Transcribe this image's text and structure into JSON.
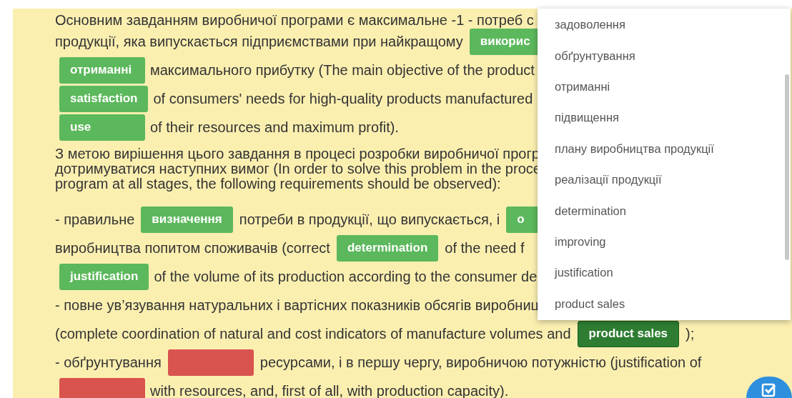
{
  "lines": [
    {
      "segments": [
        {
          "kind": "text",
          "text": "Основним завданням виробничої програми є максимальне -1 - потреб с"
        }
      ]
    },
    {
      "segments": [
        {
          "kind": "text",
          "text": "продукції, яка випускається підприємствами при найкращому"
        },
        {
          "kind": "blank",
          "text": "викорис",
          "filled": true,
          "selected": false
        }
      ]
    },
    {
      "segments": [
        {
          "kind": "blank",
          "text": "отриманні",
          "filled": true,
          "selected": false
        },
        {
          "kind": "text",
          "text": "максимального прибутку (The main objective of the product"
        }
      ]
    },
    {
      "segments": [
        {
          "kind": "blank",
          "text": "satisfaction",
          "filled": true,
          "selected": false
        },
        {
          "kind": "text",
          "text": "of consumers' needs for high-quality products manufactured"
        }
      ]
    },
    {
      "segments": [
        {
          "kind": "blank",
          "text": "use",
          "filled": true,
          "selected": false
        },
        {
          "kind": "text",
          "text": "of their resources and maximum profit)."
        }
      ]
    },
    {
      "segments": [
        {
          "kind": "text",
          "text": "З метою вирішення цього завдання в процесі розробки виробничої прогр"
        }
      ]
    },
    {
      "segments": [
        {
          "kind": "text",
          "text": "дотримуватися наступних вимог (In order to solve this problem in the proce"
        }
      ]
    },
    {
      "segments": [
        {
          "kind": "text",
          "text": "program at all stages, the following requirements should be observed):"
        }
      ]
    },
    {
      "segments": [
        {
          "kind": "text",
          "text": "- правильне"
        },
        {
          "kind": "blank",
          "text": "визначення",
          "filled": true,
          "selected": false
        },
        {
          "kind": "text",
          "text": "потреби в продукції, що випускається, і"
        },
        {
          "kind": "blank",
          "text": "о",
          "filled": true,
          "selected": false
        }
      ]
    },
    {
      "segments": [
        {
          "kind": "text",
          "text": "виробництва попитом споживачів (correct"
        },
        {
          "kind": "blank",
          "text": "determination",
          "filled": true,
          "selected": false
        },
        {
          "kind": "text",
          "text": "of the need f"
        }
      ]
    },
    {
      "segments": [
        {
          "kind": "blank",
          "text": "justification",
          "filled": true,
          "selected": false
        },
        {
          "kind": "text",
          "text": "of the volume of its production according to the consumer de"
        }
      ]
    },
    {
      "segments": [
        {
          "kind": "text",
          "text": "- повне ув’язування натуральних і вартісних показників обсягів виробниц"
        }
      ]
    },
    {
      "segments": [
        {
          "kind": "text",
          "text": "(complete coordination of natural and cost indicators of manufacture volumes and"
        },
        {
          "kind": "blank",
          "text": "product sales",
          "filled": true,
          "selected": true
        },
        {
          "kind": "text",
          "text": ");"
        }
      ]
    },
    {
      "segments": [
        {
          "kind": "text",
          "text": "- обґрунтування"
        },
        {
          "kind": "blank",
          "filled": false,
          "selected": false
        },
        {
          "kind": "text",
          "text": "ресурсами, і в першу чергу, виробничою потужністю (justification of"
        }
      ]
    },
    {
      "segments": [
        {
          "kind": "blank",
          "filled": false,
          "selected": false
        },
        {
          "kind": "text",
          "text": "with resources, and, first of all, with production capacity)."
        }
      ]
    }
  ],
  "dropdown": {
    "items": [
      "задоволення",
      "обґрунтування",
      "отриманні",
      "підвищення",
      "плану виробництва продукції",
      "реалізації продукції",
      "determination",
      "improving",
      "justification",
      "product sales"
    ]
  }
}
